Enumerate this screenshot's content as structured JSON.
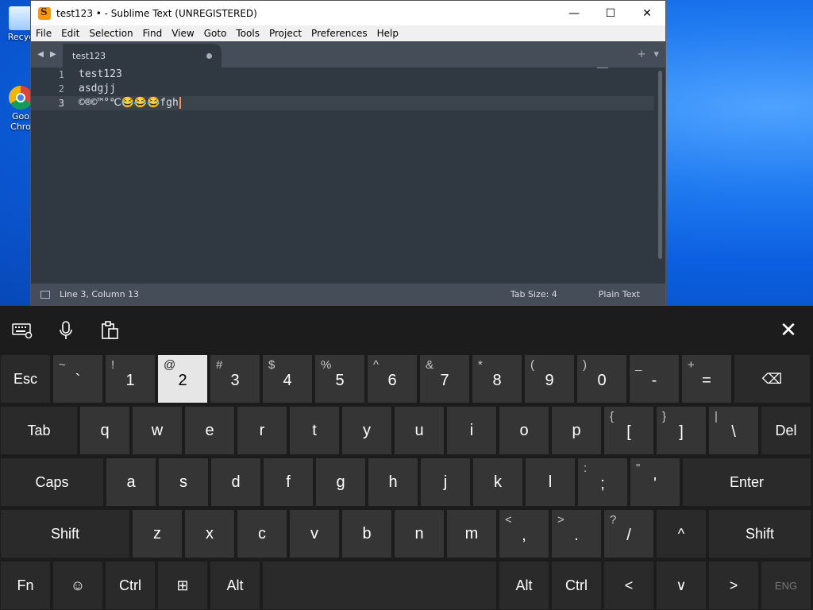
{
  "desktop": {
    "icons": [
      {
        "label": "Recyc",
        "icon": "recycle-bin-icon"
      },
      {
        "label": "Goo\nChro",
        "icon": "chrome-icon"
      }
    ]
  },
  "window": {
    "title": "test123 • - Sublime Text (UNREGISTERED)",
    "controls": {
      "minimize": "—",
      "maximize": "☐",
      "close": "✕"
    }
  },
  "menu": [
    "File",
    "Edit",
    "Selection",
    "Find",
    "View",
    "Goto",
    "Tools",
    "Project",
    "Preferences",
    "Help"
  ],
  "tab": {
    "label": "test123",
    "add": "+",
    "dropdown": "▾"
  },
  "editor": {
    "lines": [
      "test123",
      "asdgjj",
      "©®©™°℃😂😂😂fgh"
    ],
    "line_numbers": [
      "1",
      "2",
      "3"
    ],
    "active_line": 3
  },
  "status": {
    "position": "Line 3, Column 13",
    "tab_size": "Tab Size: 4",
    "syntax": "Plain Text"
  },
  "keyboard": {
    "toolbar": {
      "settings_icon": "keyboard-settings-icon",
      "mic_icon": "microphone-icon",
      "clipboard_icon": "clipboard-icon",
      "close": "✕"
    },
    "rows": [
      [
        {
          "main": "Esc",
          "type": "fn"
        },
        {
          "main": "`",
          "shift": "~"
        },
        {
          "main": "1",
          "shift": "!"
        },
        {
          "main": "2",
          "shift": "@",
          "pressed": true
        },
        {
          "main": "3",
          "shift": "#"
        },
        {
          "main": "4",
          "shift": "$"
        },
        {
          "main": "5",
          "shift": "%"
        },
        {
          "main": "6",
          "shift": "^"
        },
        {
          "main": "7",
          "shift": "&"
        },
        {
          "main": "8",
          "shift": "*"
        },
        {
          "main": "9",
          "shift": "("
        },
        {
          "main": "0",
          "shift": ")"
        },
        {
          "main": "-",
          "shift": "_"
        },
        {
          "main": "=",
          "shift": "+"
        },
        {
          "main": "⌫",
          "type": "fn"
        }
      ],
      [
        {
          "main": "Tab",
          "type": "fn"
        },
        {
          "main": "q"
        },
        {
          "main": "w"
        },
        {
          "main": "e"
        },
        {
          "main": "r"
        },
        {
          "main": "t"
        },
        {
          "main": "y"
        },
        {
          "main": "u"
        },
        {
          "main": "i"
        },
        {
          "main": "o"
        },
        {
          "main": "p"
        },
        {
          "main": "[",
          "shift": "{"
        },
        {
          "main": "]",
          "shift": "}"
        },
        {
          "main": "\\",
          "shift": "|"
        },
        {
          "main": "Del",
          "type": "fn"
        }
      ],
      [
        {
          "main": "Caps",
          "type": "fn"
        },
        {
          "main": "a"
        },
        {
          "main": "s"
        },
        {
          "main": "d"
        },
        {
          "main": "f"
        },
        {
          "main": "g"
        },
        {
          "main": "h"
        },
        {
          "main": "j"
        },
        {
          "main": "k"
        },
        {
          "main": "l"
        },
        {
          "main": ";",
          "shift": ":"
        },
        {
          "main": "'",
          "shift": "\""
        },
        {
          "main": "Enter",
          "type": "fn"
        }
      ],
      [
        {
          "main": "Shift",
          "type": "fn"
        },
        {
          "main": "z"
        },
        {
          "main": "x"
        },
        {
          "main": "c"
        },
        {
          "main": "v"
        },
        {
          "main": "b"
        },
        {
          "main": "n"
        },
        {
          "main": "m"
        },
        {
          "main": ",",
          "shift": "<"
        },
        {
          "main": ".",
          "shift": ">"
        },
        {
          "main": "/",
          "shift": "?"
        },
        {
          "main": "^",
          "type": "fn"
        },
        {
          "main": "Shift",
          "type": "fn"
        }
      ],
      [
        {
          "main": "Fn",
          "type": "fn"
        },
        {
          "main": "☺",
          "type": "fn"
        },
        {
          "main": "Ctrl",
          "type": "fn"
        },
        {
          "main": "⊞",
          "type": "fn"
        },
        {
          "main": "Alt",
          "type": "fn"
        },
        {
          "main": "",
          "type": "fn"
        },
        {
          "main": "Alt",
          "type": "fn"
        },
        {
          "main": "Ctrl",
          "type": "fn"
        },
        {
          "main": "<",
          "type": "fn"
        },
        {
          "main": "∨",
          "type": "fn"
        },
        {
          "main": ">",
          "type": "fn"
        },
        {
          "main": "ENG",
          "type": "fn",
          "dim": true
        }
      ]
    ]
  }
}
